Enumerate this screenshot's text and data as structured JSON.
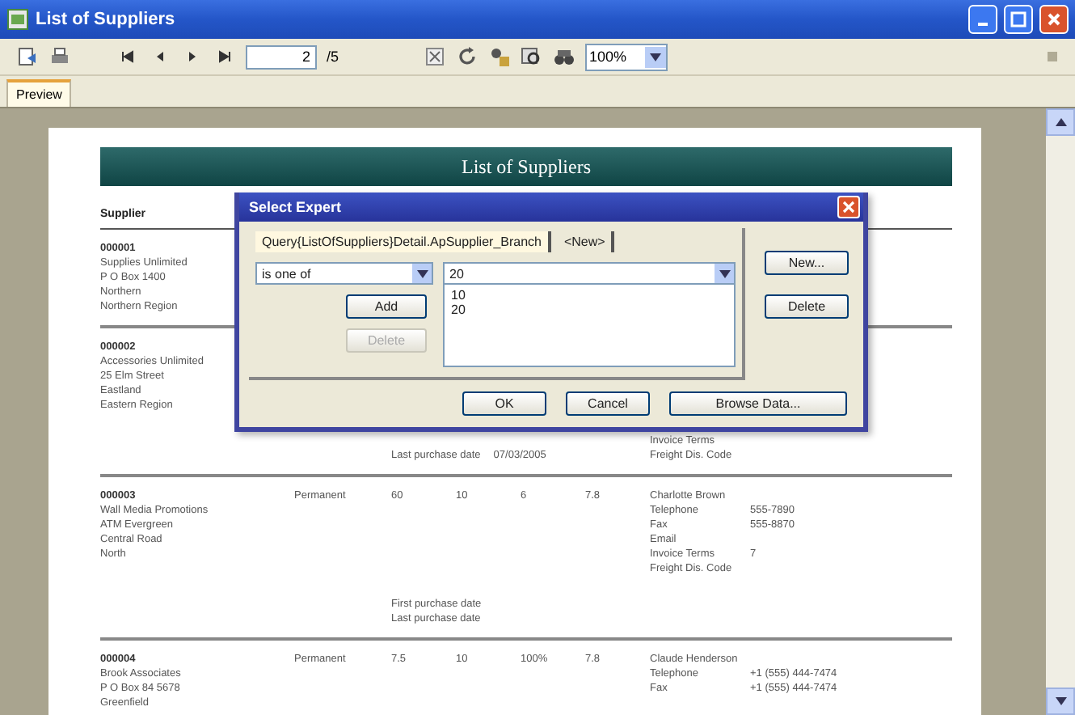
{
  "window": {
    "title": "List of Suppliers"
  },
  "toolbar": {
    "page": "2",
    "page_total": "/5",
    "zoom": "100%"
  },
  "tabs": [
    {
      "label": "Preview",
      "selected": true
    }
  ],
  "report": {
    "title": "List of Suppliers",
    "column_heading": "Supplier",
    "records": [
      {
        "id": "000001",
        "address": [
          "Supplies Unlimited",
          "P O Box 1400",
          "Northern",
          "Northern Region"
        ]
      },
      {
        "id": "000002",
        "address": [
          "Accessories Unlimited",
          "25 Elm Street",
          "Eastland",
          "Eastern Region"
        ],
        "dates": [
          {
            "label": "Last purchase date",
            "value": "07/03/2005"
          }
        ],
        "contact": {
          "fields": [
            {
              "label": "Invoice Terms"
            },
            {
              "label": "Freight Dis. Code"
            }
          ]
        }
      },
      {
        "id": "000003",
        "address": [
          "Wall Media Promotions",
          "ATM Evergreen",
          "Central Road",
          "North"
        ],
        "cells": [
          "Permanent",
          "60",
          "10",
          "6",
          "7.8"
        ],
        "dates": [
          {
            "label": "First purchase date"
          },
          {
            "label": "Last purchase date"
          }
        ],
        "contact": {
          "name": "Charlotte Brown",
          "fields": [
            {
              "label": "Telephone",
              "value": "555-7890"
            },
            {
              "label": "Fax",
              "value": "555-8870"
            },
            {
              "label": "Email"
            },
            {
              "label": "Invoice Terms",
              "value": "7"
            },
            {
              "label": "Freight Dis. Code"
            }
          ]
        }
      },
      {
        "id": "000004",
        "address": [
          "Brook Associates",
          "P O Box 84 5678",
          "Greenfield"
        ],
        "cells": [
          "Permanent",
          "7.5",
          "10",
          "100%",
          "7.8"
        ],
        "contact": {
          "name": "Claude Henderson",
          "fields": [
            {
              "label": "Telephone",
              "value": "+1 (555) 444-7474"
            },
            {
              "label": "Fax",
              "value": "+1 (555) 444-7474"
            }
          ]
        }
      }
    ]
  },
  "dialog": {
    "title": "Select Expert",
    "tabs": [
      {
        "label": "Query{ListOfSuppliers}Detail.ApSupplier_Branch",
        "selected": true
      },
      {
        "label": "<New>",
        "selected": false
      }
    ],
    "operator": "is one of",
    "value": "20",
    "values": [
      "10",
      "20"
    ],
    "inner_buttons": [
      {
        "label": "Add",
        "disabled": false
      },
      {
        "label": "Delete",
        "disabled": true
      }
    ],
    "side_buttons": [
      {
        "label": "New...",
        "disabled": false
      },
      {
        "label": "Delete",
        "disabled": false
      }
    ],
    "footer_buttons": [
      {
        "label": "OK",
        "disabled": false
      },
      {
        "label": "Cancel",
        "disabled": false
      },
      {
        "label": "Browse Data...",
        "disabled": false
      }
    ]
  }
}
